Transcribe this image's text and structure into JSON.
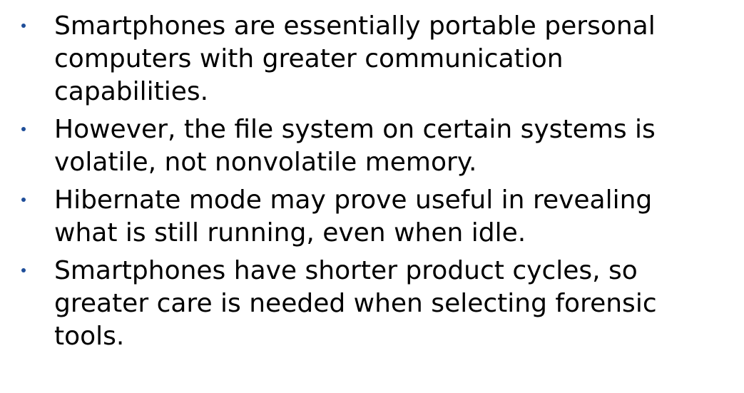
{
  "slide": {
    "bullet_color": "#1f4e99",
    "text_color": "#000000",
    "bullets": [
      {
        "text": "Smartphones are essentially portable personal computers with greater communication capabilities."
      },
      {
        "text": "However, the file system on certain systems is volatile, not nonvolatile memory."
      },
      {
        "text": "Hibernate mode may prove useful in revealing what is still running, even when idle."
      },
      {
        "text": "Smartphones have shorter product cycles, so greater care is needed when selecting forensic tools."
      }
    ]
  }
}
